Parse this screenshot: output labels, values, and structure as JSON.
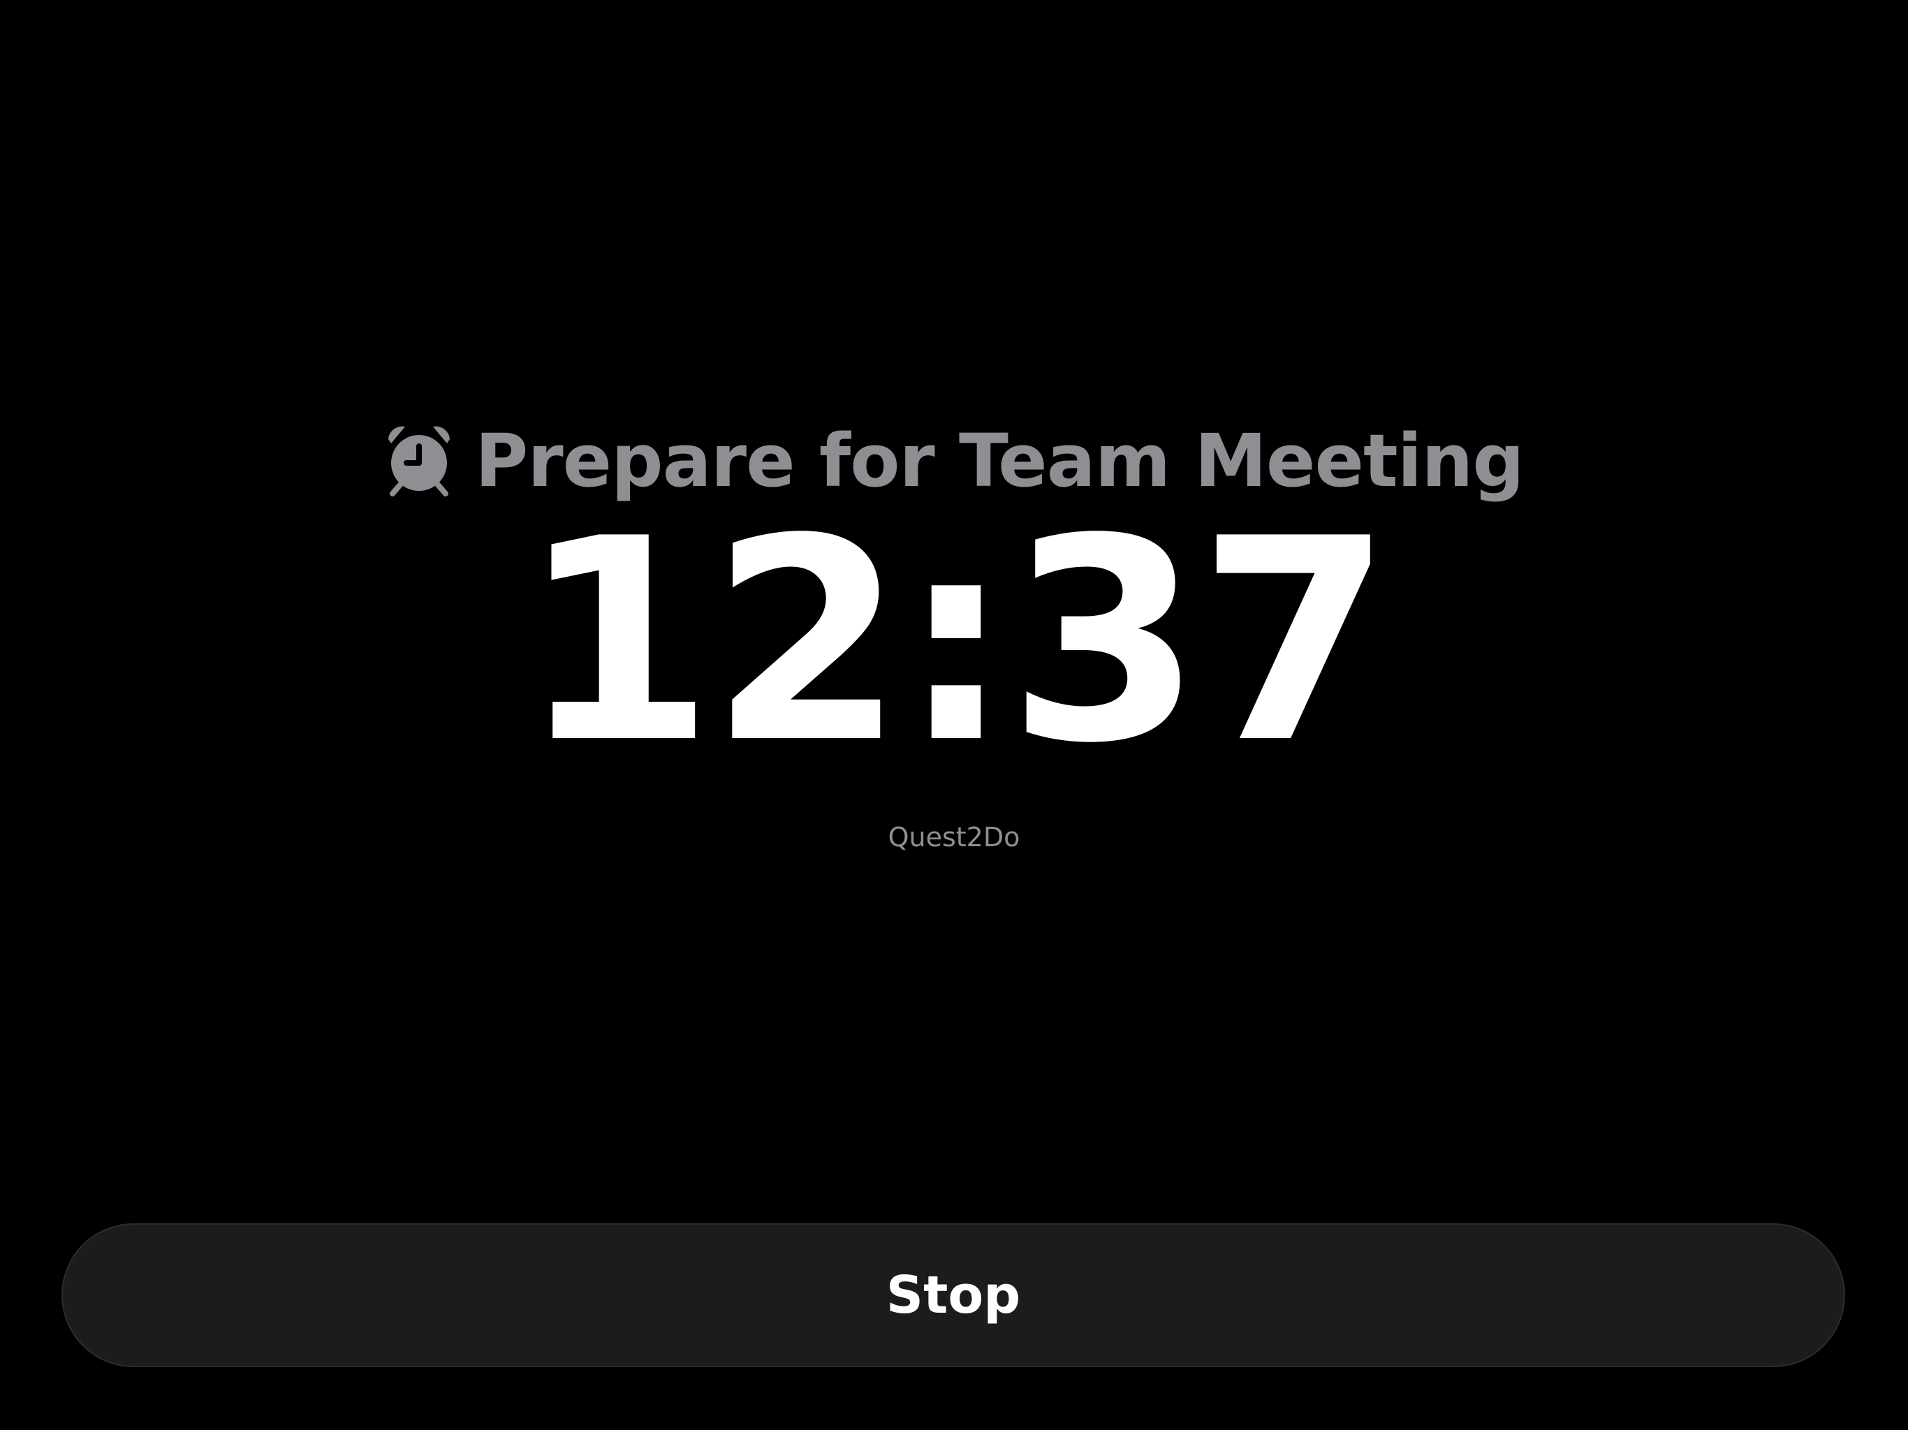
{
  "alarm": {
    "icon": "alarm-clock-icon",
    "title": "Prepare for Team Meeting"
  },
  "clock": {
    "time": "12:37"
  },
  "app": {
    "name": "Quest2Do"
  },
  "actions": {
    "stop_label": "Stop"
  },
  "colors": {
    "background": "#000000",
    "primary_text": "#ffffff",
    "secondary_text": "#8e8e93",
    "button_background": "#1c1c1e"
  }
}
